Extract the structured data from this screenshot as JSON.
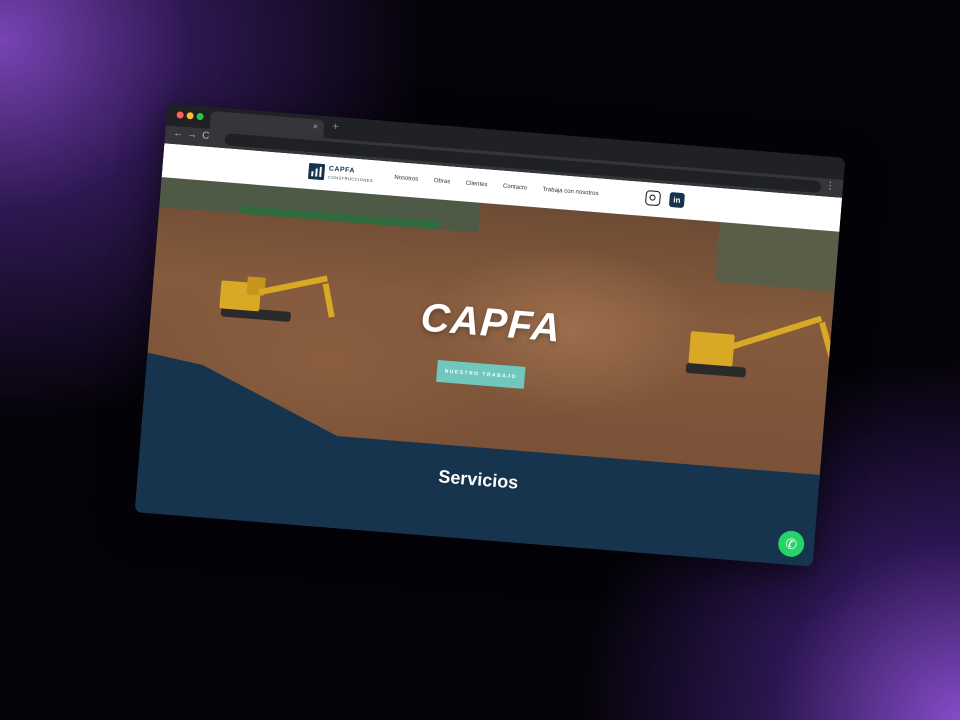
{
  "browser": {
    "tab_close": "×",
    "new_tab": "+",
    "back": "←",
    "forward": "→",
    "reload": "C",
    "menu": "⋮"
  },
  "site": {
    "logo_name": "CAPFA",
    "logo_sub": "CONSTRUCCIONES",
    "nav": [
      "Nosotros",
      "Obras",
      "Clientes",
      "Contacto",
      "Trabaja con nosotros"
    ],
    "social": {
      "linkedin": "in"
    }
  },
  "hero": {
    "title": "CAPFA",
    "button": "NUESTRO TRABAJO"
  },
  "services": {
    "title": "Servicios"
  },
  "colors": {
    "brand": "#17344f",
    "accent": "#6fc7bd",
    "whatsapp": "#25d366"
  }
}
